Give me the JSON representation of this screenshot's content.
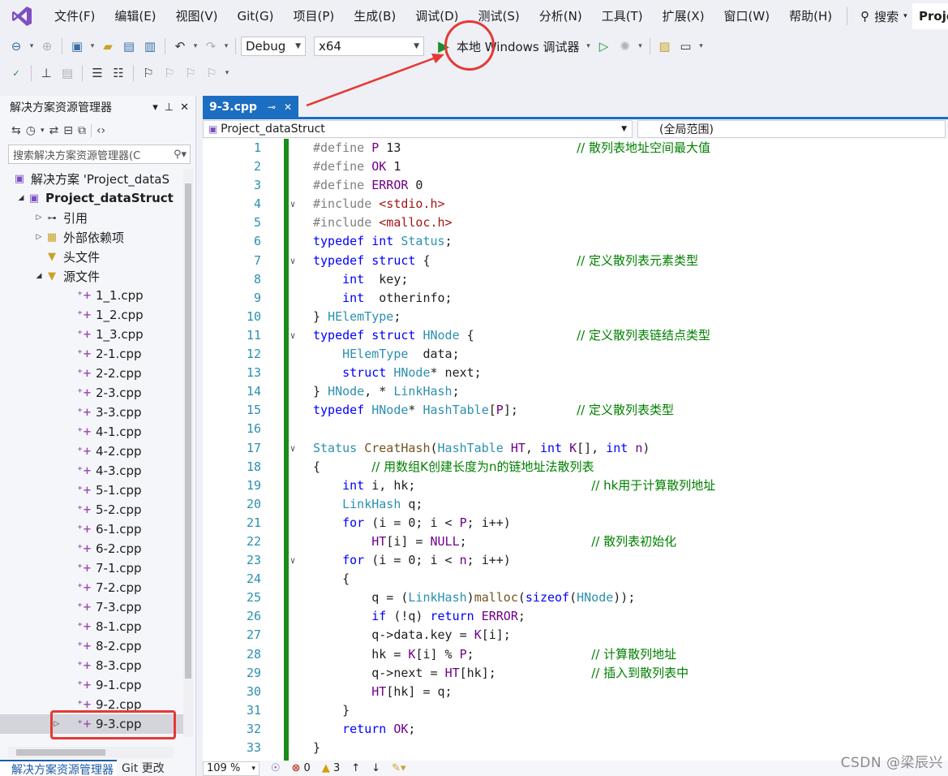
{
  "menu": {
    "items": [
      "文件(F)",
      "编辑(E)",
      "视图(V)",
      "Git(G)",
      "项目(P)",
      "生成(B)",
      "调试(D)",
      "测试(S)",
      "分析(N)",
      "工具(T)",
      "扩展(X)",
      "窗口(W)",
      "帮助(H)"
    ],
    "search_label": "搜索",
    "project_tab": "Proje"
  },
  "toolbar": {
    "config": "Debug",
    "platform": "x64",
    "run_label": "本地 Windows 调试器"
  },
  "solution_explorer": {
    "title": "解决方案资源管理器",
    "search_placeholder": "搜索解决方案资源管理器(C",
    "solution_label": "解决方案 'Project_dataS",
    "project_label": "Project_dataStruct",
    "nodes": [
      "引用",
      "外部依赖项",
      "头文件",
      "源文件"
    ],
    "files": [
      "1_1.cpp",
      "1_2.cpp",
      "1_3.cpp",
      "2-1.cpp",
      "2-2.cpp",
      "2-3.cpp",
      "3-3.cpp",
      "4-1.cpp",
      "4-2.cpp",
      "4-3.cpp",
      "5-1.cpp",
      "5-2.cpp",
      "6-1.cpp",
      "6-2.cpp",
      "7-1.cpp",
      "7-2.cpp",
      "7-3.cpp",
      "8-1.cpp",
      "8-2.cpp",
      "8-3.cpp",
      "9-1.cpp",
      "9-2.cpp",
      "9-3.cpp"
    ],
    "bottom_tabs": [
      "解决方案资源管理器",
      "Git 更改"
    ]
  },
  "editor": {
    "tab": "9-3.cpp",
    "project_combo": "Project_dataStruct",
    "scope_combo": "(全局范围)",
    "zoom": "109 %",
    "errors": "0",
    "warnings": "3"
  },
  "watermark": "CSDN @梁辰兴"
}
